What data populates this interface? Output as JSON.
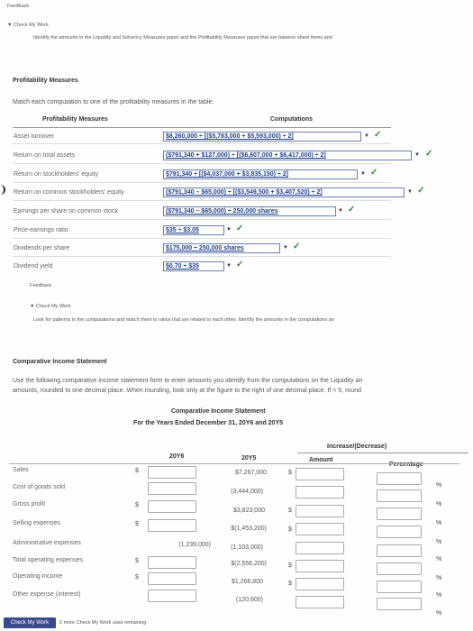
{
  "feedback_label": "Feedback",
  "check_my_work_1": "Check My Work",
  "instruction_1": "Identify the amounts in the Liquidity and Solvency Measures panel and the Profitability Measures panel that are balance sheet items and",
  "profitability": {
    "heading": "Profitability Measures",
    "instruction": "Match each computation to one of the profitability measures in the table.",
    "col_measures": "Profitability Measures",
    "col_computations": "Computations",
    "rows": [
      {
        "measure": "Asset turnover",
        "computation": "$8,260,000 ÷ [($5,783,000 + $5,593,000) ÷ 2]"
      },
      {
        "measure": "Return on total assets",
        "computation": "($791,340 + $127,000) ÷ [($6,607,000 + $6,417,000) ÷ 2]"
      },
      {
        "measure": "Return on stockholders' equity",
        "computation": "$791,340 ÷ [($4,037,000 + $3,835,150) ÷ 2]"
      },
      {
        "measure": "Return on common stockholders' equity",
        "computation": "($791,340 – $65,000) ÷ [($3,549,500 + $3,407,520) ÷ 2]"
      },
      {
        "measure": "Earnings per share on common stock",
        "computation": "($791,340 – $65,000) ÷ 250,000 shares"
      },
      {
        "measure": "Price-earnings ratio",
        "computation": "$35 ÷ $3.05"
      },
      {
        "measure": "Dividends per share",
        "computation": "$175,000 ÷ 250,000 shares"
      },
      {
        "measure": "Dividend yield",
        "computation": "$0.70 ÷ $35"
      }
    ]
  },
  "feedback_label_2": "Feedback",
  "check_my_work_2": "Check My Work",
  "instruction_2": "Look for patterns in the computations and match them to ratios that are related to each other. Identify the amounts in the computations an",
  "comparative": {
    "heading": "Comparative Income Statement",
    "instruction_line1": "Use the following comparative income statement form to enter amounts you identify from the computations on the Liquidity an",
    "instruction_line2": "amounts, rounded to one decimal place. When rounding, look only at the figure to the right of one decimal place. If < 5, round",
    "title": "Comparative Income Statement",
    "subtitle": "For the Years Ended December 31, 20Y6 and 20Y5",
    "col_increase": "Increase/(Decrease)",
    "col_20y6": "20Y6",
    "col_20y5": "20Y5",
    "col_amount": "Amount",
    "col_percentage": "Percentage",
    "rows": [
      {
        "label": "Sales",
        "y5": "$7,267,000",
        "y6": ""
      },
      {
        "label": "Cost of goods sold",
        "y5": "(3,444,000)",
        "y6": ""
      },
      {
        "label": "Gross profit",
        "y5": "$3,823,000",
        "y6": ""
      },
      {
        "label": "Selling expenses",
        "y5": "$(1,453,200)",
        "y6": ""
      },
      {
        "label": "Administrative expenses",
        "y5": "(1,103,000)",
        "y6": "(1,239,000)"
      },
      {
        "label": "Total operating expenses",
        "y5": "$(2,556,200)",
        "y6": ""
      },
      {
        "label": "Operating income",
        "y5": "$1,266,800",
        "y6": ""
      },
      {
        "label": "Other expense (interest)",
        "y5": "(120,600)",
        "y6": ""
      }
    ],
    "percent_sign": "%"
  },
  "footer": {
    "check_button": "Check My Work",
    "remaining": "2 more Check My Work uses remaining"
  }
}
